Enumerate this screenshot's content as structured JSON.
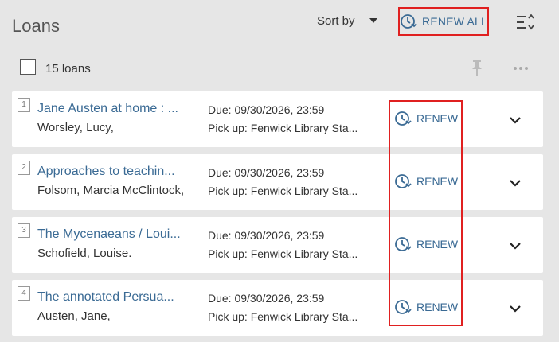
{
  "header": {
    "title": "Loans",
    "sort_label": "Sort by",
    "renew_all_label": "RENEW ALL"
  },
  "toolbar": {
    "count_label": "15 loans"
  },
  "loans": [
    {
      "number": "1",
      "title": "Jane Austen at home : ...",
      "author": "Worsley, Lucy,",
      "due": "Due: 09/30/2026, 23:59",
      "pickup": "Pick up: Fenwick Library Sta...",
      "renew_label": "RENEW"
    },
    {
      "number": "2",
      "title": "Approaches to teachin...",
      "author": "Folsom, Marcia McClintock,",
      "due": "Due: 09/30/2026, 23:59",
      "pickup": "Pick up: Fenwick Library Sta...",
      "renew_label": "RENEW"
    },
    {
      "number": "3",
      "title": "The Mycenaeans / Loui...",
      "author": "Schofield, Louise.",
      "due": "Due: 09/30/2026, 23:59",
      "pickup": "Pick up: Fenwick Library Sta...",
      "renew_label": "RENEW"
    },
    {
      "number": "4",
      "title": "The annotated Persua...",
      "author": "Austen, Jane,",
      "due": "Due: 09/30/2026, 23:59",
      "pickup": "Pick up: Fenwick Library Sta...",
      "renew_label": "RENEW"
    }
  ],
  "icons": {
    "renew": "clock-renew-icon",
    "sort_toggle": "sort-list-icon",
    "pin": "pin-icon",
    "more": "more-dots-icon",
    "expand": "chevron-down-icon"
  },
  "colors": {
    "link": "#3a6a94",
    "highlight": "#e02020",
    "background": "#e6e6e6"
  }
}
